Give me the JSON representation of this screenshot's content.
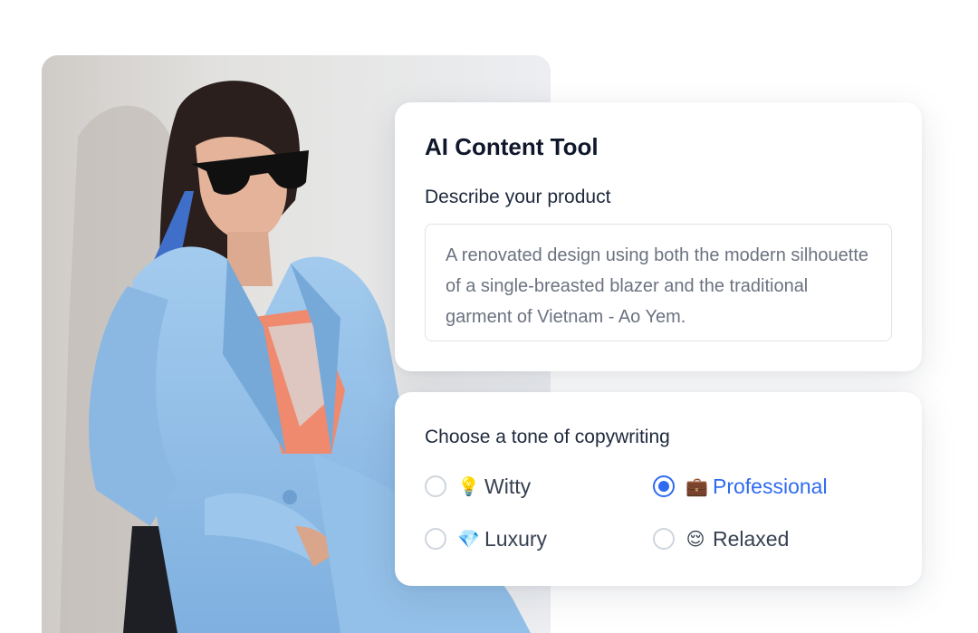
{
  "card_top": {
    "title": "AI Content Tool",
    "product_label": "Describe your product",
    "product_description": "A renovated design using both the modern silhouette of a single-breasted blazer and the traditional garment of Vietnam - Ao Yem."
  },
  "card_bottom": {
    "tone_label": "Choose a tone of copywriting",
    "options": [
      {
        "emoji": "💡",
        "icon": "lightbulb-icon",
        "label": "Witty",
        "selected": false
      },
      {
        "emoji": "💼",
        "icon": "briefcase-icon",
        "label": "Professional",
        "selected": true
      },
      {
        "emoji": "💎",
        "icon": "gem-icon",
        "label": "Luxury",
        "selected": false
      },
      {
        "emoji": "😌",
        "icon": "relieved-face-icon",
        "label": "Relaxed",
        "selected": false
      }
    ]
  },
  "colors": {
    "accent": "#2f6bf0",
    "blazer": "#8fbde6",
    "top": "#f08a6e"
  }
}
